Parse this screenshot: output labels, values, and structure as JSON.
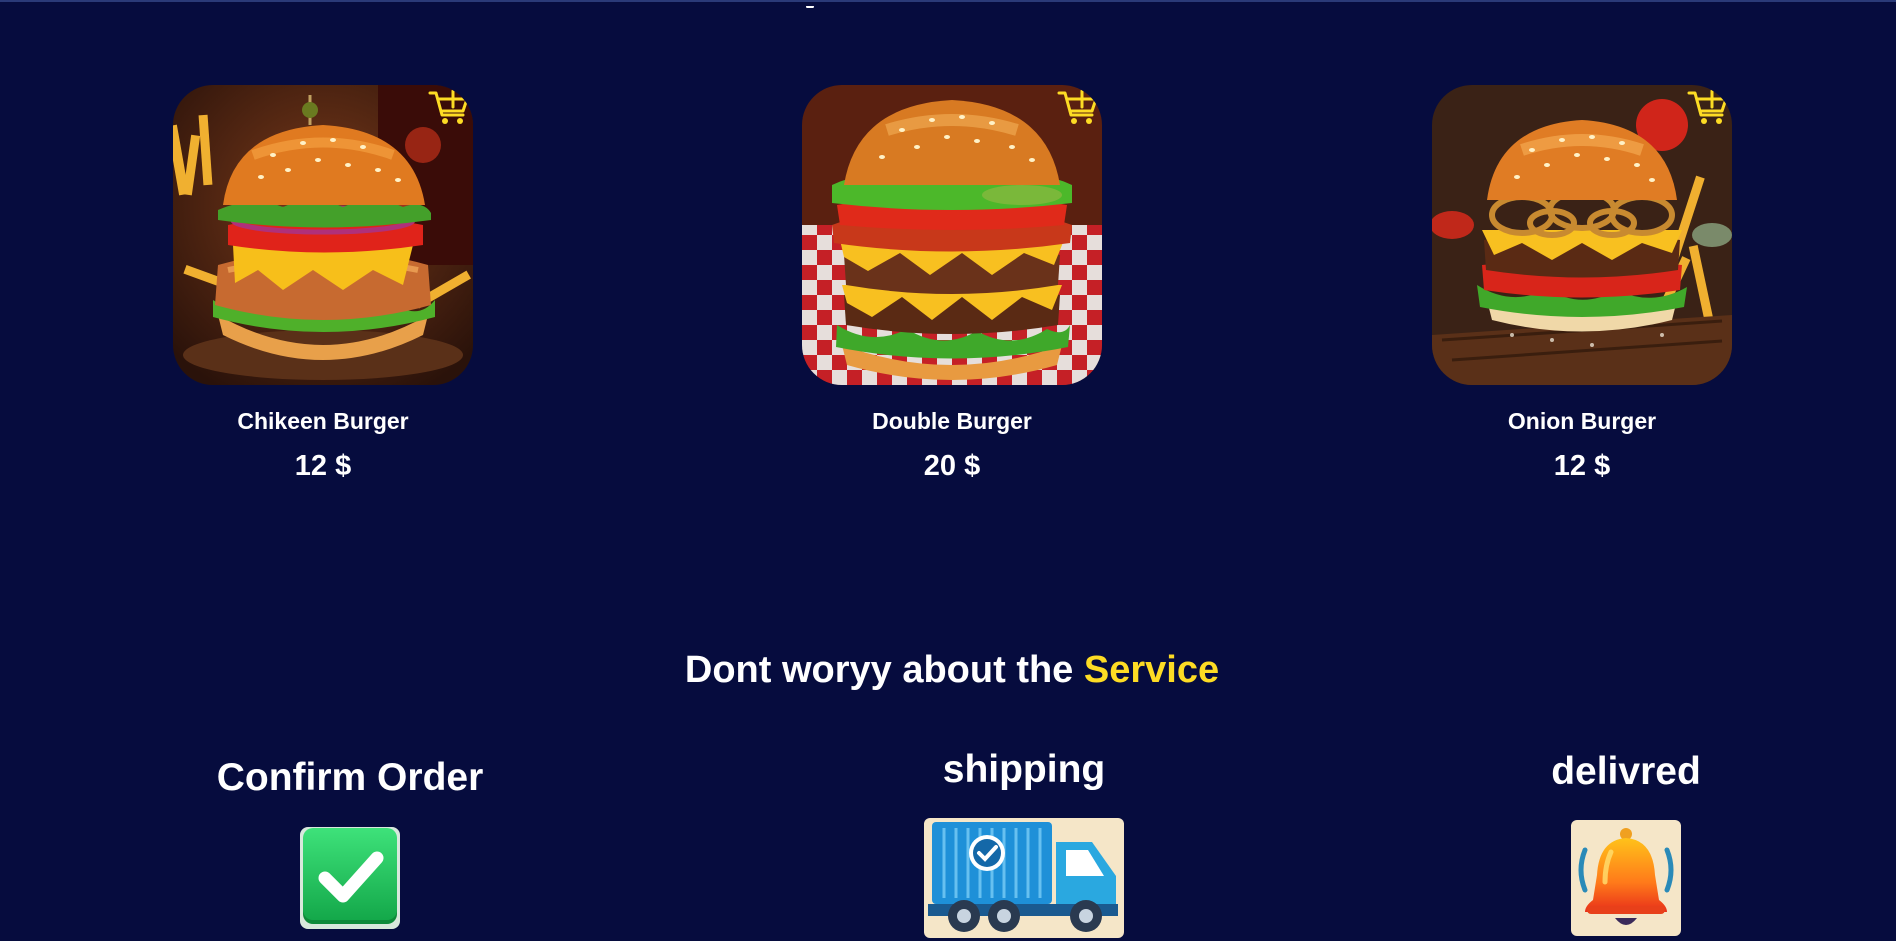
{
  "products": [
    {
      "name": "Chikeen Burger",
      "price": "12 $",
      "image_icon": "chicken-burger-photo",
      "cart_icon": "add-to-cart-icon"
    },
    {
      "name": "Double Burger",
      "price": "20 $",
      "image_icon": "double-burger-photo",
      "cart_icon": "add-to-cart-icon"
    },
    {
      "name": "Onion Burger",
      "price": "12 $",
      "image_icon": "onion-burger-photo",
      "cart_icon": "add-to-cart-icon"
    }
  ],
  "service": {
    "heading_prefix": "Dont woryy about the ",
    "heading_accent": "Service",
    "steps": [
      {
        "title": "Confirm Order",
        "icon": "check-icon"
      },
      {
        "title": "shipping",
        "icon": "truck-icon"
      },
      {
        "title": "delivred",
        "icon": "bell-icon"
      }
    ]
  },
  "colors": {
    "background": "#060c3e",
    "accent": "#fddc24",
    "text": "#ffffff"
  }
}
